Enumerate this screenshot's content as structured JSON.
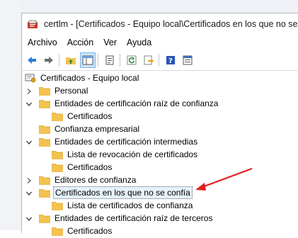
{
  "window": {
    "title": "certlm - [Certificados - Equipo local\\Certificados en los que no se confía]"
  },
  "menu": [
    "Archivo",
    "Acción",
    "Ver",
    "Ayuda"
  ],
  "toolbar": [
    {
      "icon": "back-arrow-icon"
    },
    {
      "icon": "forward-arrow-icon"
    },
    {
      "sep": true
    },
    {
      "icon": "up-folder-icon"
    },
    {
      "icon": "show-hide-console-tree-icon",
      "active": true
    },
    {
      "sep": true
    },
    {
      "icon": "properties-icon"
    },
    {
      "sep": true
    },
    {
      "icon": "refresh-icon"
    },
    {
      "icon": "export-list-icon"
    },
    {
      "sep": true
    },
    {
      "icon": "help-icon"
    },
    {
      "icon": "details-pane-icon"
    }
  ],
  "tree": {
    "root": "Certificados - Equipo local",
    "items": [
      {
        "label": "Personal",
        "level": 1,
        "expander": "collapsed"
      },
      {
        "label": "Entidades de certificación raíz de confianza",
        "level": 1,
        "expander": "expanded"
      },
      {
        "label": "Certificados",
        "level": 2,
        "expander": "none"
      },
      {
        "label": "Confianza empresarial",
        "level": 1,
        "expander": "none"
      },
      {
        "label": "Entidades de certificación intermedias",
        "level": 1,
        "expander": "expanded"
      },
      {
        "label": "Lista de revocación de certificados",
        "level": 2,
        "expander": "none"
      },
      {
        "label": "Certificados",
        "level": 2,
        "expander": "none"
      },
      {
        "label": "Editores de confianza",
        "level": 1,
        "expander": "collapsed"
      },
      {
        "label": "Certificados en los que no se confía",
        "level": 1,
        "expander": "expanded",
        "selected": true
      },
      {
        "label": "Lista de certificados de confianza",
        "level": 2,
        "expander": "none"
      },
      {
        "label": "Entidades de certificación raíz de terceros",
        "level": 1,
        "expander": "expanded"
      },
      {
        "label": "Certificados",
        "level": 2,
        "expander": "none"
      }
    ]
  },
  "annotation": {
    "color": "#e0201e"
  },
  "colors": {
    "folder": "#f3c24f",
    "folder_dark": "#d9a52e",
    "selection": "#e5f1fb",
    "arrow": "#e0201e"
  }
}
